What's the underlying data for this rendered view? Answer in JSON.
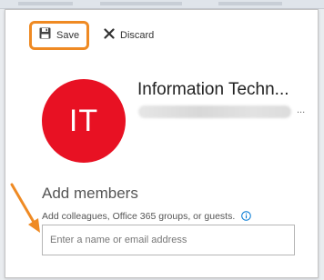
{
  "toolbar": {
    "save_label": "Save",
    "discard_label": "Discard"
  },
  "group": {
    "initials": "IT",
    "name": "Information Techn...",
    "obscured_suffix": "..."
  },
  "add_members": {
    "title": "Add members",
    "helper_text": "Add colleagues, Office 365 groups, or guests.",
    "input_placeholder": "Enter a name or email address",
    "input_value": ""
  },
  "colors": {
    "avatar": "#e81123",
    "highlight": "#ef8a23",
    "info_icon": "#0078d4"
  },
  "icons": [
    "save-icon",
    "close-icon",
    "info-icon"
  ]
}
